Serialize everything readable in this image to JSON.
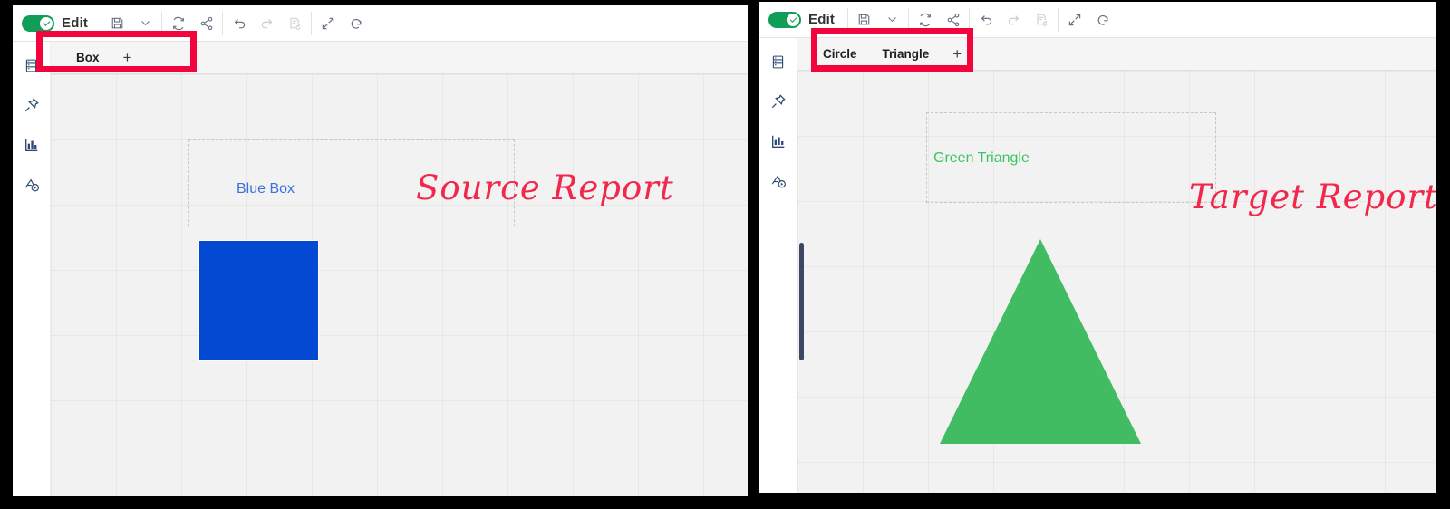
{
  "toolbar": {
    "edit_label": "Edit",
    "toggle_state": "on",
    "buttons": [
      {
        "name": "save-icon",
        "title": "Save",
        "enabled": true
      },
      {
        "name": "chevron-down-icon",
        "title": "Save options",
        "enabled": true
      },
      {
        "name": "refresh-icon",
        "title": "Refresh",
        "enabled": true
      },
      {
        "name": "share-icon",
        "title": "Share",
        "enabled": true
      },
      {
        "name": "undo-icon",
        "title": "Undo",
        "enabled": true
      },
      {
        "name": "redo-icon",
        "title": "Redo",
        "enabled": false
      },
      {
        "name": "revert-document-icon",
        "title": "Revert",
        "enabled": false
      },
      {
        "name": "expand-icon",
        "title": "Full screen",
        "enabled": true
      },
      {
        "name": "reset-icon",
        "title": "Reset",
        "enabled": true
      }
    ]
  },
  "rail": {
    "items": [
      {
        "name": "data-panel-icon",
        "label": "Data"
      },
      {
        "name": "pin-icon",
        "label": "Pin"
      },
      {
        "name": "bar-chart-icon",
        "label": "Charts"
      },
      {
        "name": "annotate-icon",
        "label": "Annotate"
      }
    ]
  },
  "source": {
    "tabs": [
      {
        "label": "Box",
        "active": true
      }
    ],
    "add_tab_label": "+",
    "widget_label": "Blue Box",
    "widget_label_color": "#3a72d8",
    "report_title": "Source Report",
    "report_title_color": "#f2274c",
    "shape": {
      "name": "blue-box",
      "type": "rectangle",
      "color": "#0449d1"
    }
  },
  "target": {
    "tabs": [
      {
        "label": "Circle",
        "active": false
      },
      {
        "label": "Triangle",
        "active": true
      }
    ],
    "add_tab_label": "+",
    "widget_label": "Green Triangle",
    "widget_label_color": "#3cc463",
    "report_title": "Target Report",
    "report_title_color": "#f2274c",
    "shape": {
      "name": "green-triangle",
      "type": "triangle",
      "color": "#42bc62"
    }
  },
  "annotations": {
    "color": "#f2043c",
    "items": [
      {
        "name": "source-tabs-highlight",
        "target": "Box tab strip"
      },
      {
        "name": "target-tabs-highlight",
        "target": "Circle / Triangle tab strip"
      }
    ]
  }
}
